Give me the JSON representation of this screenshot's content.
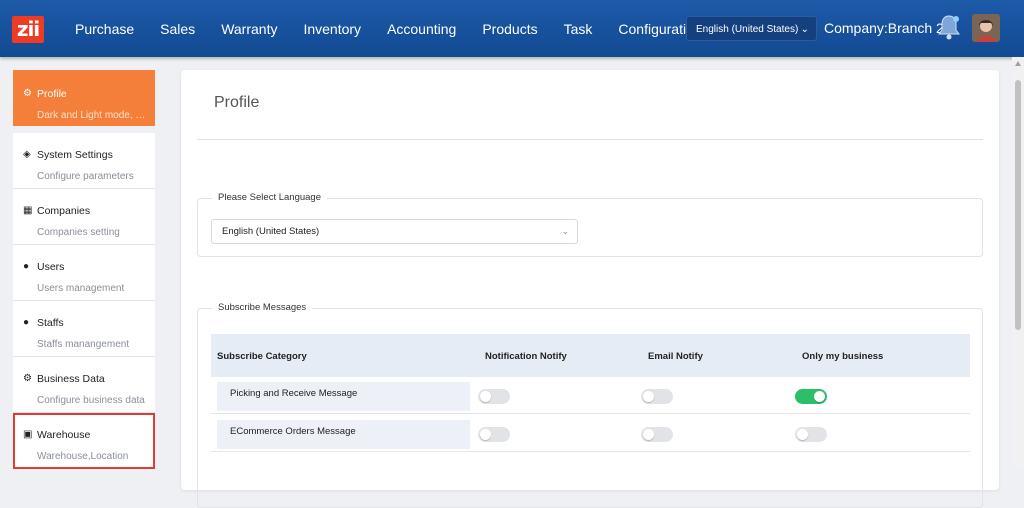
{
  "app": {
    "logo_text": "zii"
  },
  "nav": {
    "items": [
      "Purchase",
      "Sales",
      "Warranty",
      "Inventory",
      "Accounting",
      "Products",
      "Task",
      "Configuration"
    ]
  },
  "header": {
    "language_value": "English (United States)",
    "company_label": "Company:Branch 2"
  },
  "sidebar": {
    "items": [
      {
        "title": "Profile",
        "subtitle": "Dark and Light mode, L...",
        "icon": "gear-icon"
      },
      {
        "title": "System Settings",
        "subtitle": "Configure parameters",
        "icon": "tag-icon"
      },
      {
        "title": "Companies",
        "subtitle": "Companies setting",
        "icon": "building-icon"
      },
      {
        "title": "Users",
        "subtitle": "Users management",
        "icon": "users-icon"
      },
      {
        "title": "Staffs",
        "subtitle": "Staffs manangement",
        "icon": "staff-icon"
      },
      {
        "title": "Business Data",
        "subtitle": "Configure business data",
        "icon": "cog-icon"
      },
      {
        "title": "Warehouse",
        "subtitle": "Warehouse,Location",
        "icon": "warehouse-icon"
      }
    ]
  },
  "main": {
    "page_title": "Profile",
    "language_section": {
      "legend": "Please Select Language",
      "value": "English (United States)"
    },
    "subscribe_section": {
      "legend": "Subscribe Messages",
      "columns": [
        "Subscribe Category",
        "Notification Notify",
        "Email Notify",
        "Only my business"
      ],
      "rows": [
        {
          "label": "Picking and Receive Message",
          "notification": false,
          "email": false,
          "only_my_business": true
        },
        {
          "label": "ECommerce Orders Message",
          "notification": false,
          "email": false,
          "only_my_business": false
        }
      ]
    }
  },
  "colors": {
    "topbar": "#124a92",
    "active_sidebar": "#f47f3b",
    "toggle_on": "#2bbf6a",
    "highlight": "#e53935"
  }
}
